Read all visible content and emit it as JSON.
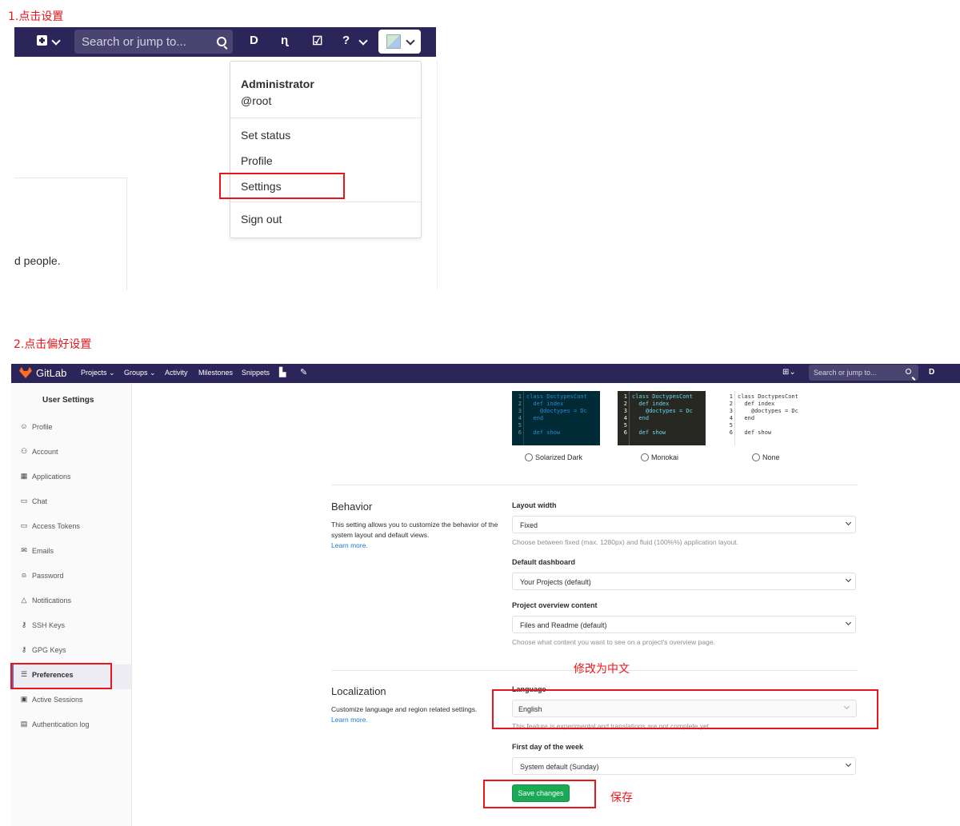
{
  "colors": {
    "navbar": "#2b2559",
    "annotation": "#e8161b",
    "save_button": "#1aaa55",
    "link": "#1f78d1",
    "gitlab_logo": "#fc6d26"
  },
  "step1": {
    "title": "1.点击设置",
    "navbar": {
      "search_placeholder": "Search or jump to...",
      "icons": [
        "plus-square-icon",
        "chevron-down-icon",
        "search-icon",
        "issues-icon",
        "merge-request-icon",
        "todo-icon",
        "help-icon",
        "avatar-icon"
      ]
    },
    "user_menu": {
      "name": "Administrator",
      "username": "@root",
      "items": [
        "Set status",
        "Profile",
        "Settings",
        "Sign out"
      ]
    },
    "background_text": "d people."
  },
  "step2": {
    "title": "2.点击偏好设置",
    "navbar": {
      "brand": "GitLab",
      "links": [
        "Projects ⌄",
        "Groups ⌄",
        "Activity",
        "Milestones",
        "Snippets"
      ],
      "search_placeholder": "Search or jump to..."
    },
    "sidebar": {
      "heading": "User Settings",
      "items": [
        {
          "label": "Profile",
          "icon": "profile-icon"
        },
        {
          "label": "Account",
          "icon": "account-icon"
        },
        {
          "label": "Applications",
          "icon": "applications-icon"
        },
        {
          "label": "Chat",
          "icon": "chat-icon"
        },
        {
          "label": "Access Tokens",
          "icon": "token-icon"
        },
        {
          "label": "Emails",
          "icon": "email-icon"
        },
        {
          "label": "Password",
          "icon": "lock-icon"
        },
        {
          "label": "Notifications",
          "icon": "bell-icon"
        },
        {
          "label": "SSH Keys",
          "icon": "key-icon"
        },
        {
          "label": "GPG Keys",
          "icon": "key-icon"
        },
        {
          "label": "Preferences",
          "icon": "preferences-icon",
          "active": true
        },
        {
          "label": "Active Sessions",
          "icon": "monitor-icon"
        },
        {
          "label": "Authentication log",
          "icon": "log-icon"
        }
      ]
    },
    "syntax_themes": {
      "line_numbers": "1\n2\n3\n4\n5\n6",
      "code": "class DoctypesCont\n  def index\n    @doctypes = Dc\n  end\n\n  def show",
      "options": [
        "Solarized Dark",
        "Monokai",
        "None"
      ]
    },
    "behavior": {
      "title": "Behavior",
      "description": "This setting allows you to customize the behavior of the system layout and default views.",
      "learn_more": "Learn more.",
      "layout_width": {
        "label": "Layout width",
        "value": "Fixed",
        "help": "Choose between fixed (max. 1280px) and fluid (100%%) application layout."
      },
      "default_dashboard": {
        "label": "Default dashboard",
        "value": "Your Projects (default)"
      },
      "project_overview": {
        "label": "Project overview content",
        "value": "Files and Readme (default)",
        "help": "Choose what content you want to see on a project's overview page."
      }
    },
    "localization": {
      "title": "Localization",
      "description": "Customize language and region related settings.",
      "learn_more": "Learn more.",
      "language": {
        "label": "Language",
        "value": "English",
        "help": "This feature is experimental and translations are not complete yet."
      },
      "first_day": {
        "label": "First day of the week",
        "value": "System default (Sunday)"
      }
    },
    "save_label": "Save changes",
    "annotation_language": "修改为中文",
    "annotation_save": "保存"
  }
}
